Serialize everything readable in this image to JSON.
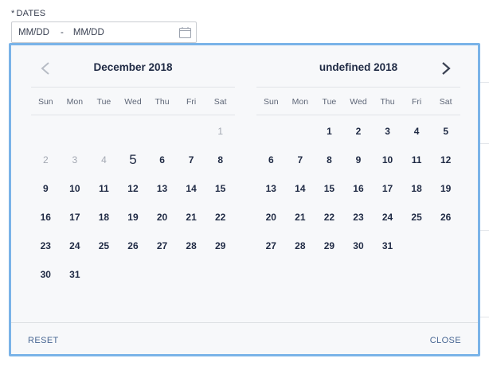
{
  "field": {
    "required_mark": "*",
    "label": "DATES",
    "start_placeholder": "MM/DD",
    "separator": "-",
    "end_placeholder": "MM/DD"
  },
  "calendar": {
    "prev_icon": "chevron-left-icon",
    "next_icon": "chevron-right-icon",
    "weekdays": [
      "Sun",
      "Mon",
      "Tue",
      "Wed",
      "Thu",
      "Fri",
      "Sat"
    ],
    "left": {
      "title": "December 2018",
      "weeks": [
        [
          "",
          "",
          "",
          "",
          "",
          "",
          "1"
        ],
        [
          "2",
          "3",
          "4",
          "5",
          "6",
          "7",
          "8"
        ],
        [
          "9",
          "10",
          "11",
          "12",
          "13",
          "14",
          "15"
        ],
        [
          "16",
          "17",
          "18",
          "19",
          "20",
          "21",
          "22"
        ],
        [
          "23",
          "24",
          "25",
          "26",
          "27",
          "28",
          "29"
        ],
        [
          "30",
          "31",
          "",
          "",
          "",
          "",
          ""
        ]
      ],
      "muted_days": [
        "1",
        "2",
        "3",
        "4"
      ],
      "today": "5"
    },
    "right": {
      "title": "undefined 2018",
      "weeks": [
        [
          "",
          "",
          "1",
          "2",
          "3",
          "4",
          "5"
        ],
        [
          "6",
          "7",
          "8",
          "9",
          "10",
          "11",
          "12"
        ],
        [
          "13",
          "14",
          "15",
          "16",
          "17",
          "18",
          "19"
        ],
        [
          "20",
          "21",
          "22",
          "23",
          "24",
          "25",
          "26"
        ],
        [
          "27",
          "28",
          "29",
          "30",
          "31",
          "",
          ""
        ]
      ],
      "muted_days": [],
      "today": ""
    }
  },
  "footer": {
    "reset_label": "RESET",
    "close_label": "CLOSE"
  },
  "colors": {
    "popup_border": "#7ab3e8",
    "link": "#4a6894",
    "day_text": "#1f2a44",
    "muted_day": "#a3a8b2"
  }
}
